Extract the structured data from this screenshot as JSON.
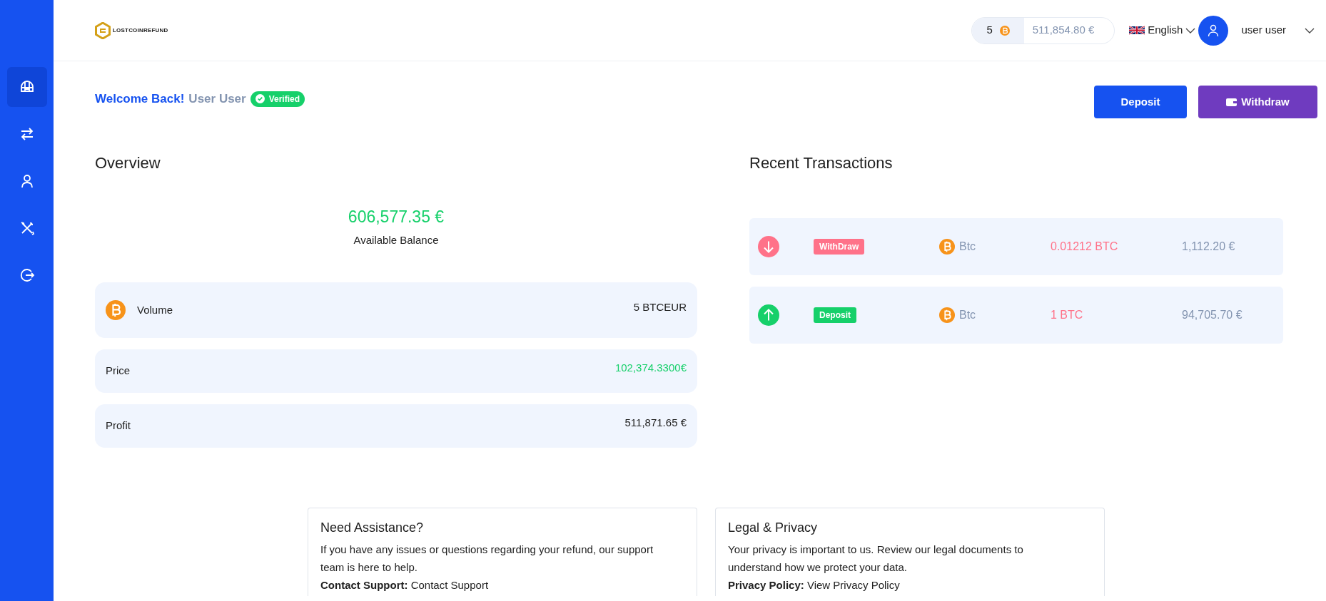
{
  "sidebar": {
    "items": [
      {
        "selected": true
      },
      {
        "selected": false
      },
      {
        "selected": false
      },
      {
        "selected": false
      },
      {
        "selected": false
      }
    ]
  },
  "header": {
    "logo_text": "LOSTCOINREFUND",
    "coin_count": "5",
    "balance": "511,854.80 €",
    "language": "English",
    "user_name": "user user"
  },
  "welcome": {
    "greeting": "Welcome Back!",
    "name": "User User",
    "badge": "Verified",
    "verified": true
  },
  "actions": [
    {
      "kind": "deposit",
      "label": "Deposit"
    },
    {
      "kind": "withdraw",
      "label": "Withdraw"
    }
  ],
  "overview": {
    "title": "Overview",
    "balance": "606,577.35 €",
    "balance_label": "Available Balance",
    "stats": [
      {
        "label": "Volume",
        "value": "5 BTCEUR",
        "coin": true,
        "highlight": false
      },
      {
        "label": "Price",
        "value": "102,374.3300€",
        "coin": false,
        "highlight": true
      },
      {
        "label": "Profit",
        "value": "511,871.65 €",
        "coin": false,
        "highlight": false
      }
    ]
  },
  "transactions": {
    "title": "Recent Transactions",
    "rows": [
      {
        "kind": "withdraw",
        "type": "WithDraw",
        "currency": "Btc",
        "amount": "0.01212 BTC",
        "value": "1,112.20 €"
      },
      {
        "kind": "deposit",
        "type": "Deposit",
        "currency": "Btc",
        "amount": "1 BTC",
        "value": "94,705.70 €"
      }
    ]
  },
  "footer": [
    {
      "title": "Need Assistance?",
      "text": "If you have any issues or questions regarding your refund, our support team is here to help.",
      "link_label": "Contact Support:",
      "link": "Contact Support"
    },
    {
      "title": "Legal & Privacy",
      "text": "Your privacy is important to us. Review our legal documents to understand how we protect your data.",
      "link_label": "Privacy Policy:",
      "link": "View Privacy Policy"
    }
  ]
}
